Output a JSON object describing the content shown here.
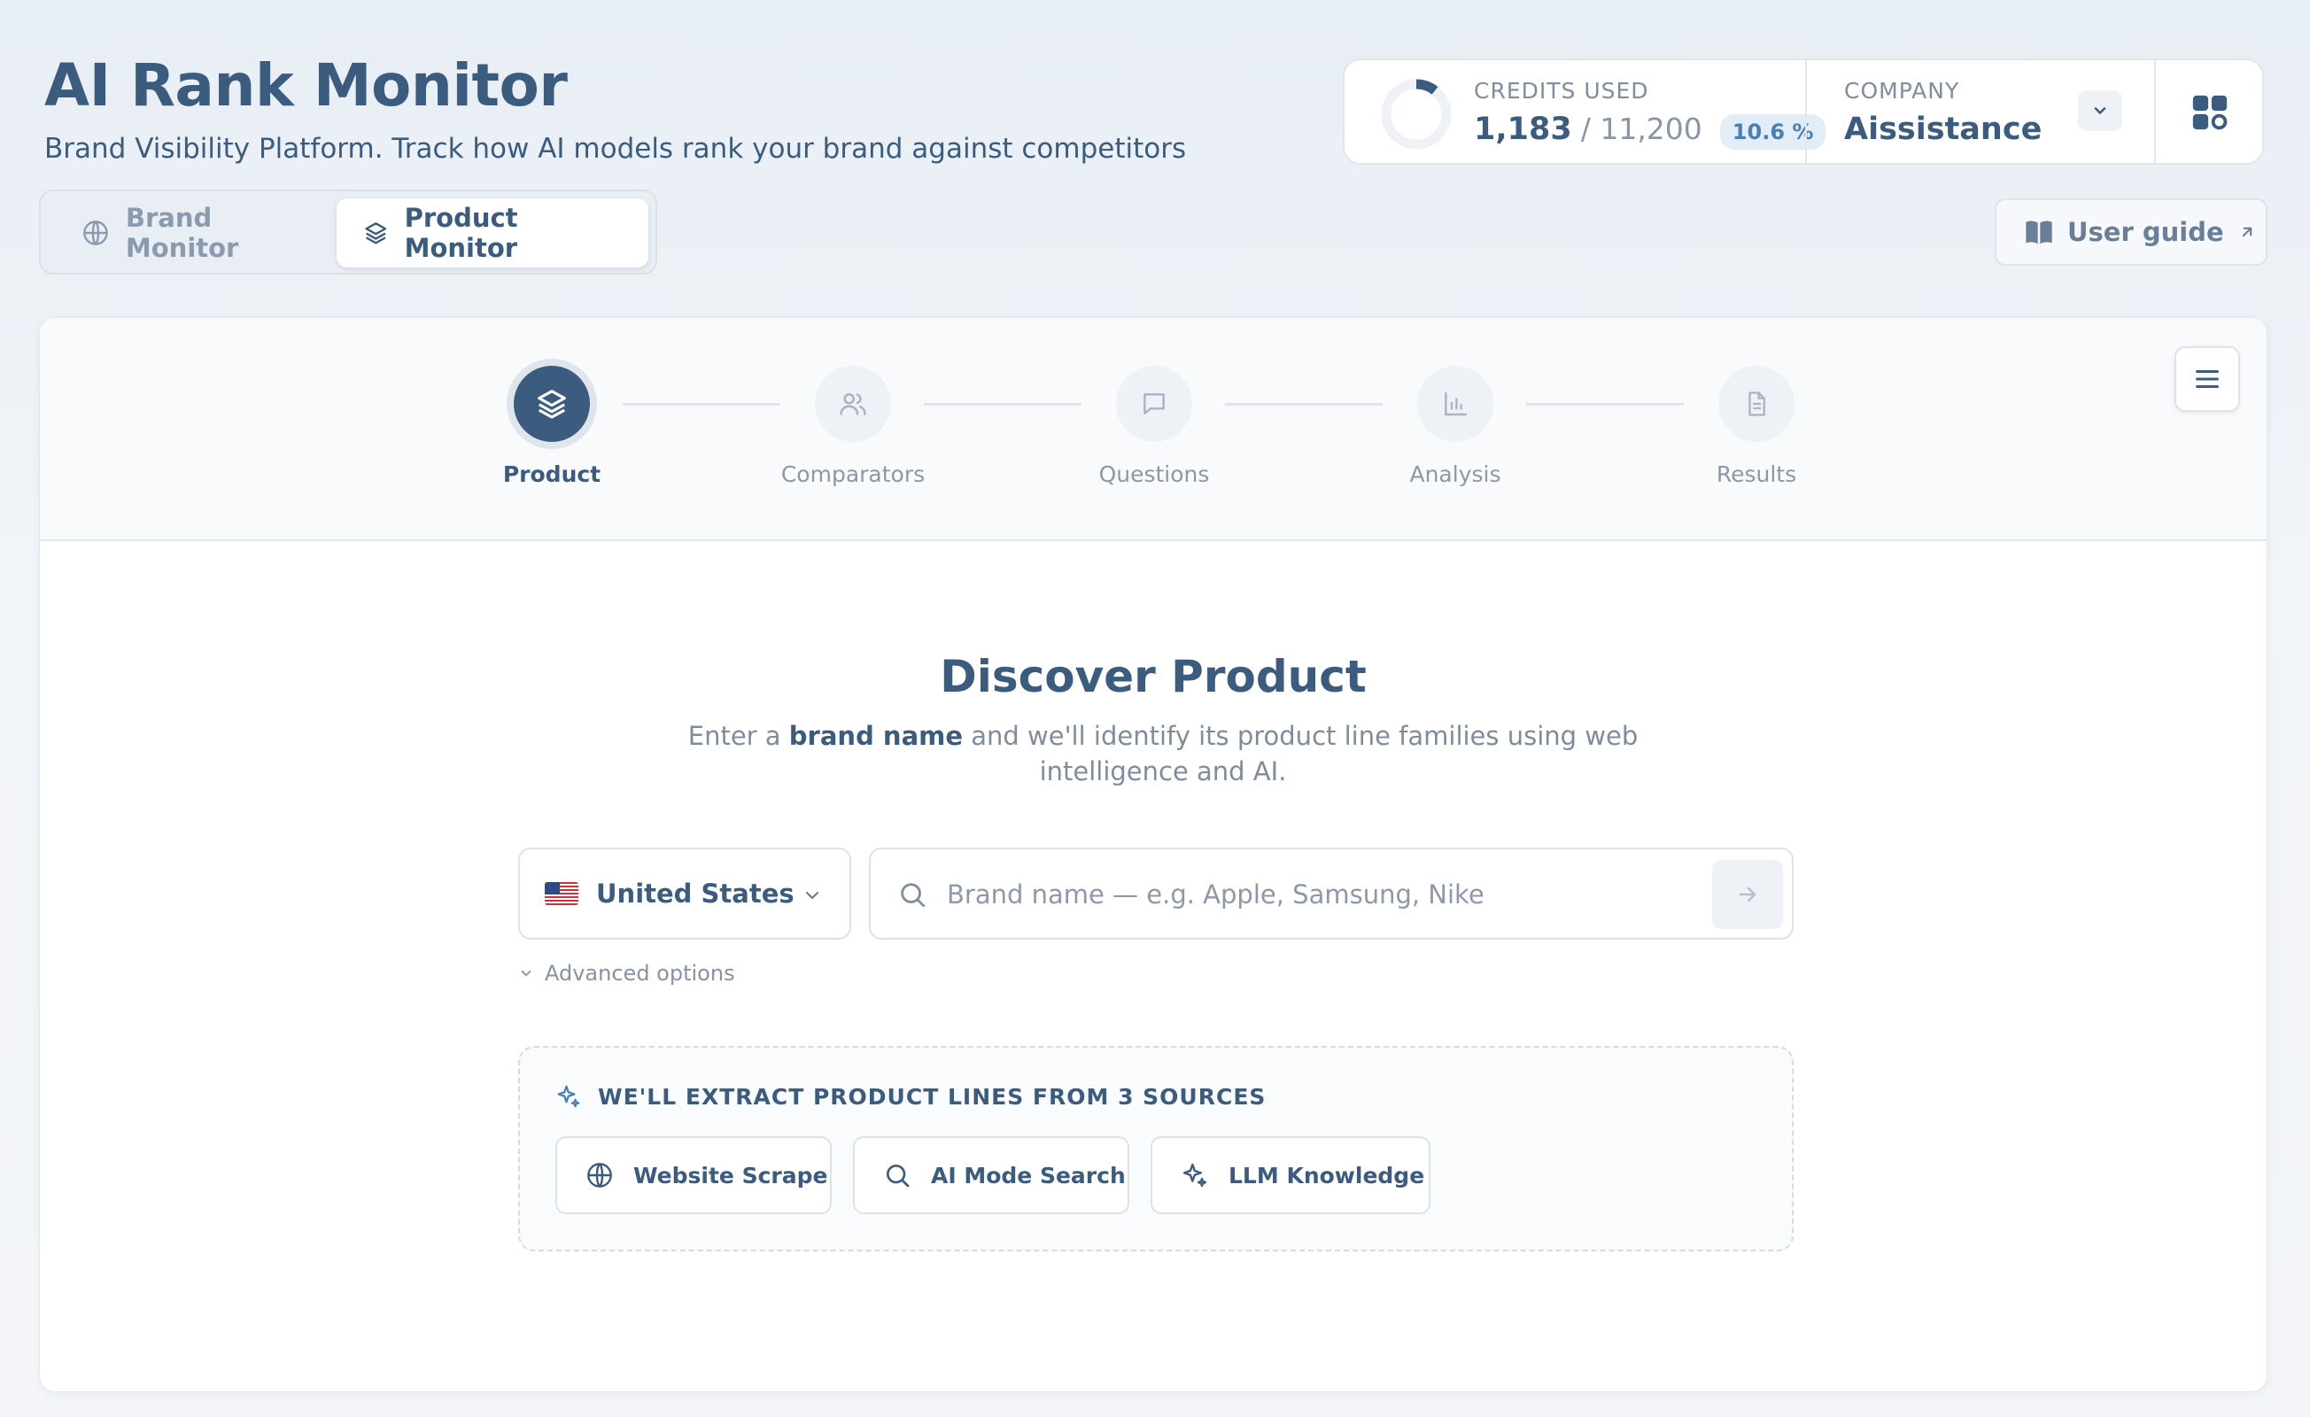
{
  "app": {
    "title": "AI Rank Monitor",
    "subtitle": "Brand Visibility Platform. Track how AI models rank your brand against competitors"
  },
  "modes": [
    {
      "label": "Brand Monitor",
      "icon": "globe-icon",
      "active": false
    },
    {
      "label": "Product Monitor",
      "icon": "layers-icon",
      "active": true
    }
  ],
  "credits": {
    "label": "CREDITS USED",
    "used": "1,183",
    "total": "/ 11,200",
    "percent": "10.6 %",
    "fraction": 0.106
  },
  "company": {
    "label": "COMPANY",
    "name": "Aissistance"
  },
  "user_guide": {
    "label": "User guide",
    "icon": "book-icon"
  },
  "stepper": [
    {
      "label": "Product",
      "icon": "layers-icon",
      "active": true
    },
    {
      "label": "Comparators",
      "icon": "users-icon",
      "active": false
    },
    {
      "label": "Questions",
      "icon": "message-icon",
      "active": false
    },
    {
      "label": "Analysis",
      "icon": "bar-chart-icon",
      "active": false
    },
    {
      "label": "Results",
      "icon": "document-icon",
      "active": false
    }
  ],
  "discover": {
    "title": "Discover Product",
    "sub_pre": "Enter a ",
    "sub_bold": "brand name",
    "sub_post": " and we'll identify its product line families using web intelligence and AI."
  },
  "country": {
    "selected": "United States",
    "flag": "us-flag-icon"
  },
  "search": {
    "placeholder": "Brand name — e.g. Apple, Samsung, Nike",
    "value": ""
  },
  "advanced": {
    "label": "Advanced options"
  },
  "sources": {
    "heading": "WE'LL EXTRACT PRODUCT LINES FROM 3 SOURCES",
    "items": [
      {
        "label": "Website Scrape",
        "icon": "globe-icon"
      },
      {
        "label": "AI Mode Search",
        "icon": "search-icon"
      },
      {
        "label": "LLM Knowledge",
        "icon": "sparkles-icon"
      }
    ]
  },
  "colors": {
    "primary": "#3b5b7f",
    "accent": "#4b7fb3",
    "muted": "#8a98aa",
    "background": "#eef2f6"
  }
}
